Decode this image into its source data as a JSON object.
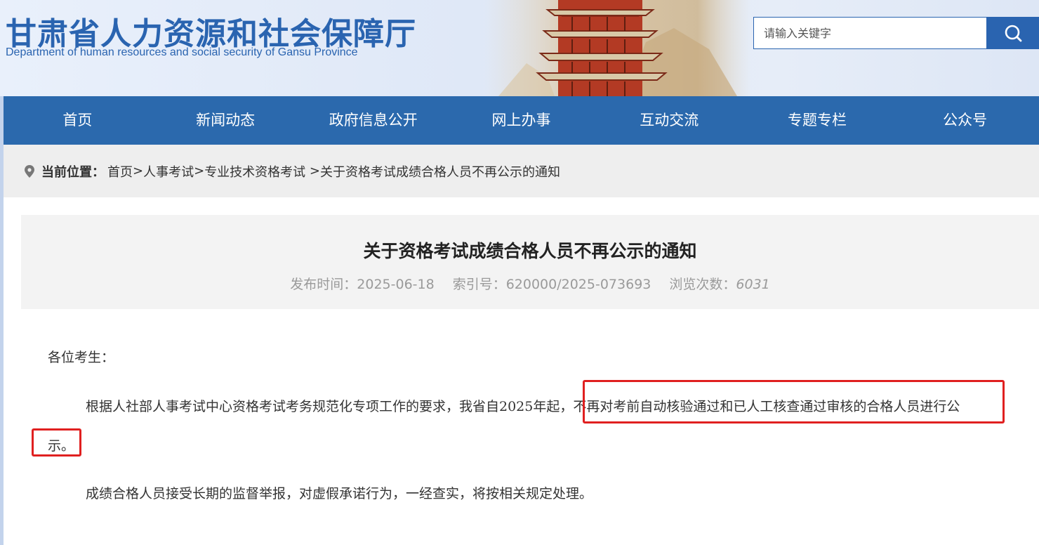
{
  "header": {
    "title": "甘肃省人力资源和社会保障厅",
    "subtitle": "Department of human resources and social security of Gansu Province",
    "search_placeholder": "请输入关键字"
  },
  "nav": {
    "items": [
      "首页",
      "新闻动态",
      "政府信息公开",
      "网上办事",
      "互动交流",
      "专题专栏",
      "公众号"
    ]
  },
  "breadcrumb": {
    "label": "当前位置：",
    "items": [
      "首页",
      "人事考试",
      "专业技术资格考试 ",
      "关于资格考试成绩合格人员不再公示的通知"
    ],
    "separator": ">"
  },
  "article": {
    "title": "关于资格考试成绩合格人员不再公示的通知",
    "publish_label": "发布时间：",
    "publish_date": "2025-06-18",
    "index_label": "索引号：",
    "index_value": "620000/2025-073693",
    "views_label": "浏览次数：",
    "views_value": "6031",
    "greeting": "各位考生：",
    "para1_part1": "根据人社部人事考试中心资格考试考务规范化专项工作的要求，我省自2025年起，",
    "para1_highlight1": "不再对考前自动核验通过和已人工核查通过审核的合格人员进行公",
    "para1_highlight2": "示。",
    "para2": "成绩合格人员接受长期的监督举报，对虚假承诺行为，一经查实，将按相关规定处理。"
  },
  "colors": {
    "brand_blue": "#2b69ad",
    "highlight_red": "#e02020"
  }
}
